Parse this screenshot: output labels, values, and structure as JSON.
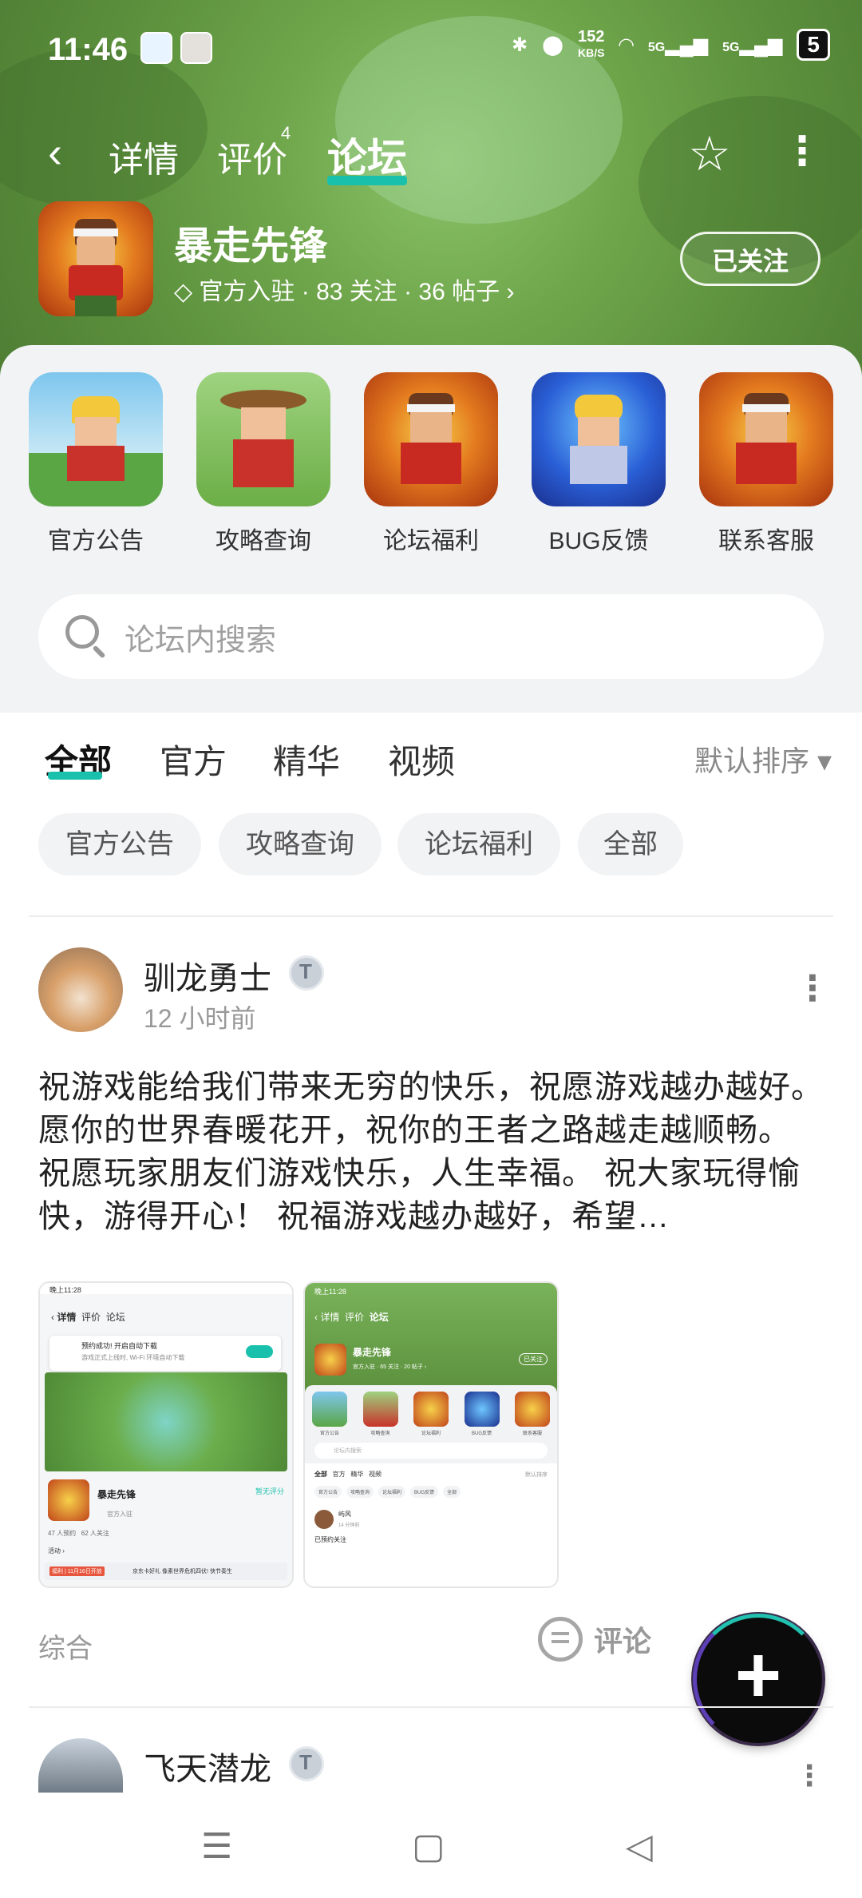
{
  "status_bar": {
    "time": "11:46",
    "speed_value": "152",
    "speed_unit": "KB/S",
    "net_1": "5G",
    "net_2": "5G",
    "battery": "5"
  },
  "nav": {
    "tabs": [
      {
        "label": "详情"
      },
      {
        "label": "评价"
      },
      {
        "label": "论坛"
      }
    ],
    "review_count": "4"
  },
  "game": {
    "name": "暴走先锋",
    "meta": "官方入驻 · 83 关注 · 36 帖子 ›",
    "follow_label": "已关注"
  },
  "quick_entries": [
    {
      "label": "官方公告"
    },
    {
      "label": "攻略查询"
    },
    {
      "label": "论坛福利"
    },
    {
      "label": "BUG反馈"
    },
    {
      "label": "联系客服"
    }
  ],
  "search": {
    "placeholder": "论坛内搜索"
  },
  "feed_tabs": [
    {
      "label": "全部"
    },
    {
      "label": "官方"
    },
    {
      "label": "精华"
    },
    {
      "label": "视频"
    }
  ],
  "sort_label": "默认排序 ▾",
  "chips": [
    {
      "label": "官方公告"
    },
    {
      "label": "攻略查询"
    },
    {
      "label": "论坛福利"
    },
    {
      "label": "全部"
    }
  ],
  "post": {
    "author": "驯龙勇士",
    "time": "12 小时前",
    "text": "祝游戏能给我们带来无穷的快乐，祝愿游戏越办越好。 愿你的世界春暖花开，祝你的王者之路越走越顺畅。 祝愿玩家朋友们游戏快乐，人生幸福。 祝大家玩得愉快，游得开心！ 祝福游戏越办越好，希望…",
    "category": "综合",
    "comment_label": "评论",
    "shot1": {
      "time": "晚上11:28",
      "tabs": [
        "详情",
        "评价",
        "论坛"
      ],
      "notice_title": "预约成功! 开启自动下载",
      "notice_sub": "游戏正式上线时, Wi-Fi 环境自动下载",
      "game_name": "暴走先锋",
      "rating": "暂无评分",
      "official": "官方入驻",
      "stats": "47 人预约   62 人关注",
      "activity": "活动 ›",
      "tag": "福利 | 11月16日开放",
      "promo": "京东卡好礼 像素世界危机四伏! 快节奏生"
    },
    "shot2": {
      "time": "晚上11:28",
      "tabs": [
        "详情",
        "评价",
        "论坛"
      ],
      "game_name": "暴走先锋",
      "meta": "官方入驻 · 65 关注 · 20 帖子 ›",
      "follow": "已关注",
      "entries": [
        "官方公告",
        "攻略查询",
        "论坛福利",
        "BUG反馈",
        "联系客服"
      ],
      "search": "论坛内搜索",
      "feed_tabs": [
        "全部",
        "官方",
        "精华",
        "视频"
      ],
      "sort": "默认排序",
      "chips": [
        "官方公告",
        "攻略查询",
        "论坛福利",
        "BUG反馈",
        "全部"
      ],
      "author": "屿风",
      "time2": "14 分钟前",
      "text": "已预约关注"
    }
  },
  "post2": {
    "author": "飞天潜龙"
  },
  "colors": {
    "accent": "#19c1ad",
    "header_green": "#6fa64b",
    "sheet_bg": "#f2f3f5"
  }
}
